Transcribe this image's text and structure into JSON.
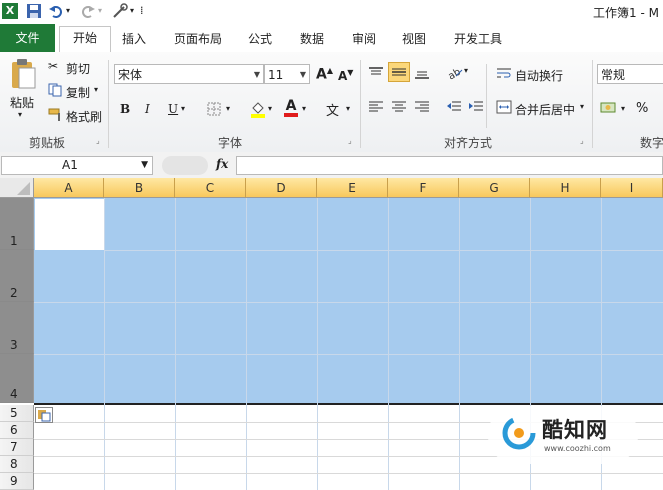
{
  "window": {
    "title": "工作簿1 - M"
  },
  "tabs": [
    {
      "label": "文件"
    },
    {
      "label": "开始"
    },
    {
      "label": "插入"
    },
    {
      "label": "页面布局"
    },
    {
      "label": "公式"
    },
    {
      "label": "数据"
    },
    {
      "label": "审阅"
    },
    {
      "label": "视图"
    },
    {
      "label": "开发工具"
    }
  ],
  "clipboard": {
    "paste": "粘贴",
    "cut": "剪切",
    "copy": "复制",
    "format_painter": "格式刷",
    "group": "剪贴板"
  },
  "font": {
    "name": "宋体",
    "size": "11",
    "bold": "B",
    "italic": "I",
    "underline": "U",
    "font_color_glyph": "A",
    "phonetic": "文",
    "group": "字体"
  },
  "alignment": {
    "wrap": "自动换行",
    "merge": "合并后居中",
    "group": "对齐方式"
  },
  "number": {
    "format": "常规",
    "percent": "%",
    "group": "数字"
  },
  "formula_bar": {
    "name_box": "A1",
    "fx": "fx",
    "value": ""
  },
  "columns": [
    "A",
    "B",
    "C",
    "D",
    "E",
    "F",
    "G",
    "H",
    "I"
  ],
  "rows": [
    "1",
    "2",
    "3",
    "4",
    "5",
    "6",
    "7",
    "8",
    "9"
  ],
  "watermark": {
    "brand": "酷知网",
    "url": "www.coozhi.com"
  },
  "colors": {
    "selection": "#a6cbee",
    "file_tab": "#1f7a37",
    "header_selected": "#f8c85c"
  }
}
